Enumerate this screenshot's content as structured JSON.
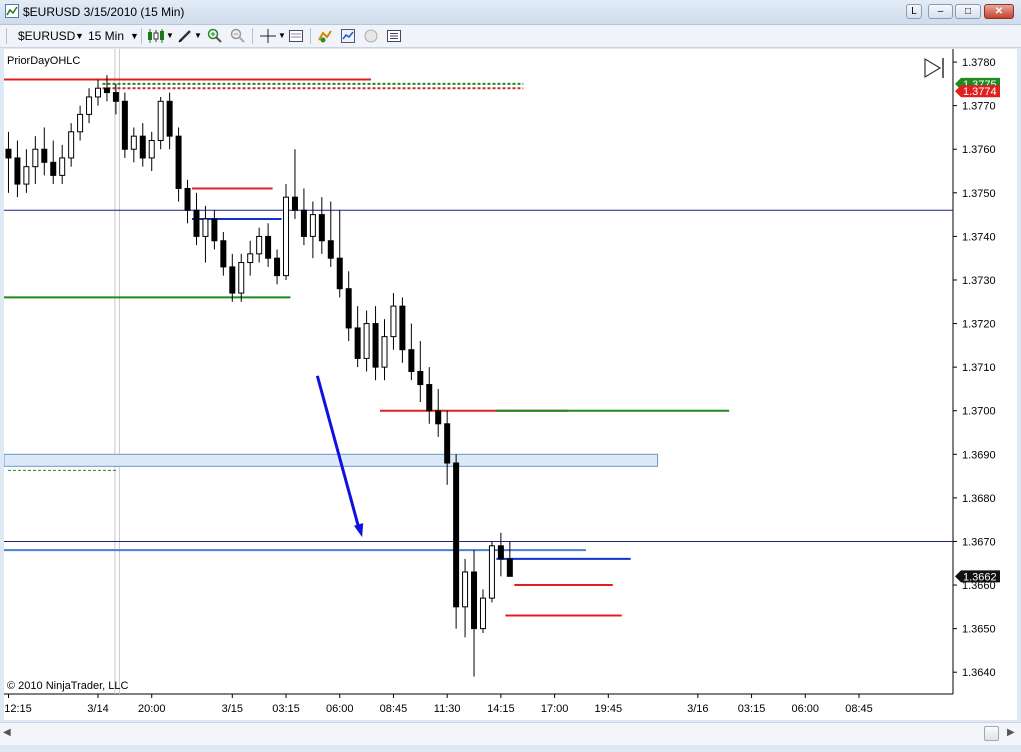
{
  "window": {
    "title": "$EURUSD  3/15/2010 (15 Min)",
    "buttons": {
      "link": "L",
      "minimize": "–",
      "maximize": "□",
      "close": "✕"
    }
  },
  "toolbar": {
    "instrument": "$EURUSD",
    "interval": "15 Min",
    "icons": [
      "candlestick-style-icon",
      "pencil-draw-icon",
      "zoom-in-icon",
      "zoom-out-icon",
      "crosshair-icon",
      "data-box-icon",
      "strategy-icon",
      "indicator-icon",
      "alert-icon",
      "properties-icon"
    ]
  },
  "chart_data": {
    "type": "candlestick",
    "indicator_label": "PriorDayOHLC",
    "copyright": "© 2010 NinjaTrader, LLC",
    "ylim": [
      1.3635,
      1.3783
    ],
    "y_ticks": [
      "1.3640",
      "1.3650",
      "1.3660",
      "1.3670",
      "1.3680",
      "1.3690",
      "1.3700",
      "1.3710",
      "1.3720",
      "1.3730",
      "1.3740",
      "1.3750",
      "1.3760",
      "1.3770",
      "1.3780"
    ],
    "x_ticks": [
      {
        "label": "12:15",
        "i": 0
      },
      {
        "label": "3/14",
        "i": 10
      },
      {
        "label": "20:00",
        "i": 16
      },
      {
        "label": "3/15",
        "i": 25
      },
      {
        "label": "03:15",
        "i": 31
      },
      {
        "label": "06:00",
        "i": 37
      },
      {
        "label": "08:45",
        "i": 43
      },
      {
        "label": "11:30",
        "i": 49
      },
      {
        "label": "14:15",
        "i": 55
      },
      {
        "label": "17:00",
        "i": 61
      },
      {
        "label": "19:45",
        "i": 67
      },
      {
        "label": "3/16",
        "i": 77
      },
      {
        "label": "03:15",
        "i": 83
      },
      {
        "label": "06:00",
        "i": 89
      },
      {
        "label": "08:45",
        "i": 95
      }
    ],
    "x_slots": 106,
    "candles": [
      [
        1.376,
        1.3764,
        1.375,
        1.3758
      ],
      [
        1.3758,
        1.3762,
        1.3749,
        1.3752
      ],
      [
        1.3752,
        1.376,
        1.375,
        1.3756
      ],
      [
        1.3756,
        1.3763,
        1.3752,
        1.376
      ],
      [
        1.376,
        1.3765,
        1.3754,
        1.3757
      ],
      [
        1.3757,
        1.3762,
        1.3752,
        1.3754
      ],
      [
        1.3754,
        1.3761,
        1.3752,
        1.3758
      ],
      [
        1.3758,
        1.3766,
        1.3756,
        1.3764
      ],
      [
        1.3764,
        1.377,
        1.3762,
        1.3768
      ],
      [
        1.3768,
        1.3774,
        1.3766,
        1.3772
      ],
      [
        1.3772,
        1.3776,
        1.377,
        1.3774
      ],
      [
        1.3774,
        1.3777,
        1.3771,
        1.3773
      ],
      [
        1.3773,
        1.3775,
        1.3768,
        1.3771
      ],
      [
        1.3771,
        1.3773,
        1.3758,
        1.376
      ],
      [
        1.376,
        1.3765,
        1.3757,
        1.3763
      ],
      [
        1.3763,
        1.3766,
        1.3756,
        1.3758
      ],
      [
        1.3758,
        1.3764,
        1.3755,
        1.3762
      ],
      [
        1.3762,
        1.3772,
        1.376,
        1.3771
      ],
      [
        1.3771,
        1.3773,
        1.376,
        1.3763
      ],
      [
        1.3763,
        1.3765,
        1.3748,
        1.3751
      ],
      [
        1.3751,
        1.3753,
        1.3743,
        1.3746
      ],
      [
        1.3746,
        1.375,
        1.3738,
        1.374
      ],
      [
        1.374,
        1.3747,
        1.3734,
        1.3744
      ],
      [
        1.3744,
        1.3746,
        1.3737,
        1.3739
      ],
      [
        1.3739,
        1.3741,
        1.3731,
        1.3733
      ],
      [
        1.3733,
        1.3736,
        1.3725,
        1.3727
      ],
      [
        1.3727,
        1.3736,
        1.3725,
        1.3734
      ],
      [
        1.3734,
        1.3739,
        1.3731,
        1.3736
      ],
      [
        1.3736,
        1.3742,
        1.3734,
        1.374
      ],
      [
        1.374,
        1.3743,
        1.3733,
        1.3735
      ],
      [
        1.3735,
        1.3737,
        1.3729,
        1.3731
      ],
      [
        1.3731,
        1.3752,
        1.373,
        1.3749
      ],
      [
        1.3749,
        1.376,
        1.3744,
        1.3746
      ],
      [
        1.3746,
        1.3751,
        1.3738,
        1.374
      ],
      [
        1.374,
        1.3748,
        1.3735,
        1.3745
      ],
      [
        1.3745,
        1.3749,
        1.3736,
        1.3739
      ],
      [
        1.3739,
        1.3748,
        1.3733,
        1.3735
      ],
      [
        1.3735,
        1.3746,
        1.3726,
        1.3728
      ],
      [
        1.3728,
        1.3732,
        1.3716,
        1.3719
      ],
      [
        1.3719,
        1.3724,
        1.371,
        1.3712
      ],
      [
        1.3712,
        1.3723,
        1.3709,
        1.372
      ],
      [
        1.372,
        1.3724,
        1.3707,
        1.371
      ],
      [
        1.371,
        1.3721,
        1.3707,
        1.3717
      ],
      [
        1.3717,
        1.3727,
        1.3714,
        1.3724
      ],
      [
        1.3724,
        1.3726,
        1.3711,
        1.3714
      ],
      [
        1.3714,
        1.372,
        1.3707,
        1.3709
      ],
      [
        1.3709,
        1.3716,
        1.3702,
        1.3706
      ],
      [
        1.3706,
        1.371,
        1.3697,
        1.37
      ],
      [
        1.37,
        1.3705,
        1.3694,
        1.3697
      ],
      [
        1.3697,
        1.37,
        1.3683,
        1.3688
      ],
      [
        1.3688,
        1.369,
        1.365,
        1.3655
      ],
      [
        1.3655,
        1.3666,
        1.3648,
        1.3663
      ],
      [
        1.3663,
        1.3668,
        1.3639,
        1.365
      ],
      [
        1.365,
        1.3659,
        1.3649,
        1.3657
      ],
      [
        1.3657,
        1.367,
        1.3656,
        1.3669
      ],
      [
        1.3669,
        1.3672,
        1.3662,
        1.3666
      ],
      [
        1.3666,
        1.367,
        1.3662,
        1.3662
      ]
    ],
    "levels": [
      {
        "price": 1.3776,
        "from": 0,
        "to": 41,
        "color": "#e02020",
        "dash": false
      },
      {
        "price": 1.3775,
        "from": 11,
        "to": 58,
        "color": "#1f8a1f",
        "dash": true
      },
      {
        "price": 1.3774,
        "from": 11,
        "to": 58,
        "color": "#c03030",
        "dash": true
      },
      {
        "price": 1.3751,
        "from": 21,
        "to": 30,
        "color": "#e02020",
        "dash": false
      },
      {
        "price": 1.3746,
        "from": 0,
        "to": 106,
        "color": "#1a237e",
        "dash": false,
        "thin": true
      },
      {
        "price": 1.3744,
        "from": 21,
        "to": 31,
        "color": "#1030d0",
        "dash": false
      },
      {
        "price": 1.3726,
        "from": 0,
        "to": 32,
        "color": "#1f8a1f",
        "dash": false
      },
      {
        "price": 1.37,
        "from": 42,
        "to": 63,
        "color": "#e02020",
        "dash": false
      },
      {
        "price": 1.37,
        "from": 55,
        "to": 81,
        "color": "#1f8a1f",
        "dash": false
      },
      {
        "price": 1.367,
        "from": 0,
        "to": 106,
        "color": "#1a237e",
        "dash": false,
        "thin": true
      },
      {
        "price": 1.3668,
        "from": 0,
        "to": 65,
        "color": "#4a7fd6",
        "dash": false
      },
      {
        "price": 1.3666,
        "from": 55,
        "to": 70,
        "color": "#1030d0",
        "dash": false
      },
      {
        "price": 1.366,
        "from": 57,
        "to": 68,
        "color": "#e02020",
        "dash": false
      },
      {
        "price": 1.3653,
        "from": 56,
        "to": 69,
        "color": "#e02020",
        "dash": false
      }
    ],
    "zone": {
      "top": 1.369,
      "bottom": 1.3688,
      "from": 0,
      "to": 73
    },
    "zone_dash": {
      "price": 1.3687,
      "from": 0,
      "to": 12,
      "color": "#1f8a1f"
    },
    "arrow": {
      "from": [
        34.5,
        1.3708
      ],
      "to": [
        39.5,
        1.3671
      ],
      "color": "#1010e0"
    },
    "price_markers": [
      {
        "label": "1.3775",
        "price": 1.3775,
        "color": "#1f8a1f"
      },
      {
        "label": "1.3774",
        "price": 1.3774,
        "color": "#e02020"
      },
      {
        "label": "1.3662",
        "price": 1.3662,
        "color": "#111111"
      }
    ],
    "vertical_markers": [
      12,
      12.5
    ]
  }
}
